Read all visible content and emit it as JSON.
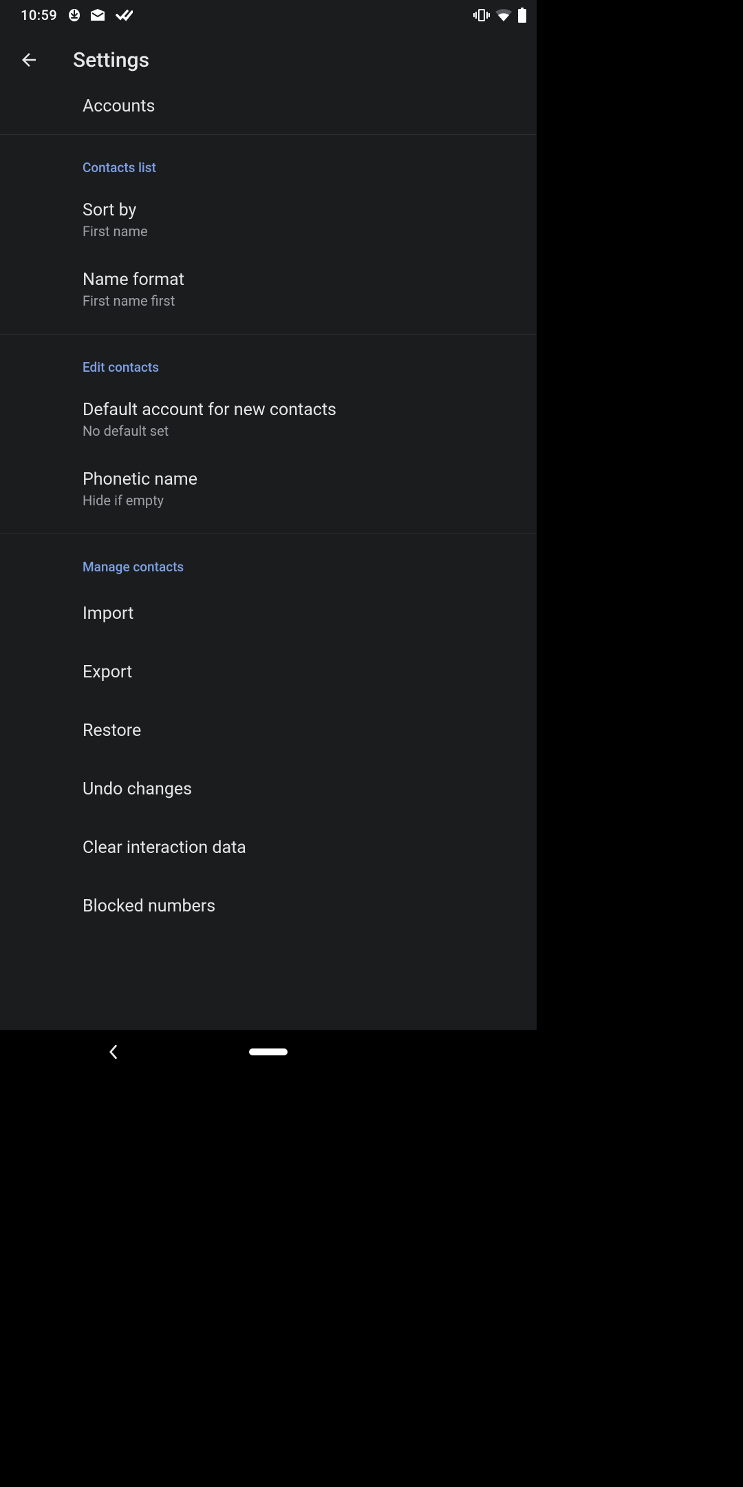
{
  "status": {
    "time": "10:59"
  },
  "header": {
    "title": "Settings"
  },
  "partial": {
    "accounts": "Accounts"
  },
  "sections": {
    "contacts_list": {
      "header": "Contacts list",
      "sort_by": {
        "title": "Sort by",
        "value": "First name"
      },
      "name_format": {
        "title": "Name format",
        "value": "First name first"
      }
    },
    "edit_contacts": {
      "header": "Edit contacts",
      "default_account": {
        "title": "Default account for new contacts",
        "value": "No default set"
      },
      "phonetic_name": {
        "title": "Phonetic name",
        "value": "Hide if empty"
      }
    },
    "manage_contacts": {
      "header": "Manage contacts",
      "import": "Import",
      "export": "Export",
      "restore": "Restore",
      "undo": "Undo changes",
      "clear": "Clear interaction data",
      "blocked": "Blocked numbers"
    }
  }
}
